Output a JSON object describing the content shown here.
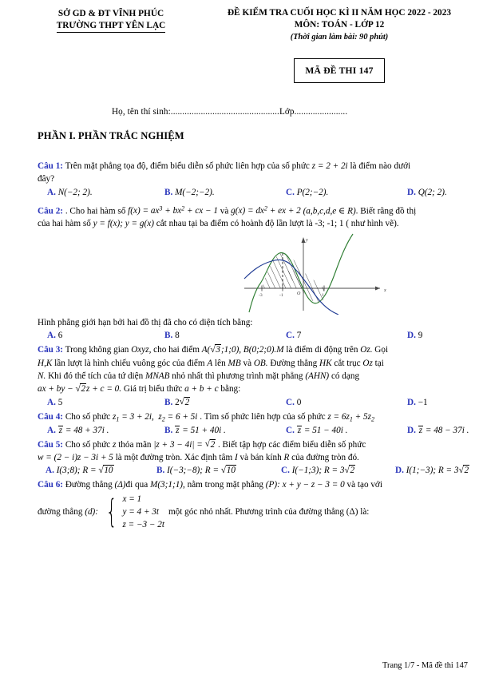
{
  "header": {
    "left_line1": "SỞ GD & ĐT VĨNH PHÚC",
    "left_line2": "TRƯỜNG THPT YÊN LẠC",
    "right_line1": "ĐỀ KIỂM TRA CUỐI HỌC KÌ II NĂM HỌC 2022 - 2023",
    "right_line2": "MÔN: TOÁN - LỚP 12",
    "right_line3": "(Thời gian làm bài: 90 phút)",
    "exam_code": "MÃ ĐỀ THI 147"
  },
  "student_line": "Họ, tên thí sinh:...............................................Lớp.......................",
  "section_title": "PHẦN I. PHẦN TRẮC NGHIỆM",
  "questions": [
    {
      "label": "Câu 1:",
      "text_line1": "Trên mặt phẳng tọa độ, điểm biểu diễn số phức liên hợp của số phức",
      "math1": "z = 2 + 2i",
      "text_line1b": "là điểm nào dưới",
      "text_line2": "đây?",
      "options": [
        {
          "letter": "A.",
          "value": "N(−2; 2)."
        },
        {
          "letter": "B.",
          "value": "M(−2;−2)."
        },
        {
          "letter": "C.",
          "value": "P(2;−2)."
        },
        {
          "letter": "D.",
          "value": "Q(2; 2)."
        }
      ]
    },
    {
      "label": "Câu 2:",
      "text_a": ". Cho hai hàm số",
      "math_f": "f(x) = ax³ + bx² + cx − 1",
      "text_b": "và",
      "math_g": "g(x) = dx² + ex + 2",
      "math_cond": "(a,b,c,d,e ∈ R)",
      "text_c": ". Biết rằng đồ thị",
      "text_line2a": "của hai hàm số",
      "math_yy": "y = f(x); y = g(x)",
      "text_line2b": "cắt nhau tại ba điểm có hoành độ lần lượt là -3; -1; 1 ( như hình vẽ).",
      "after_figure": "Hình phẳng giới hạn bởi hai đồ thị đã cho có diện tích bằng:",
      "options": [
        {
          "letter": "A.",
          "value": "6"
        },
        {
          "letter": "B.",
          "value": "8"
        },
        {
          "letter": "C.",
          "value": "7"
        },
        {
          "letter": "D.",
          "value": "9"
        }
      ]
    },
    {
      "label": "Câu 3:",
      "text_1a": "Trong không gian",
      "math_oxyz": "Oxyz,",
      "text_1b": "cho hai điểm",
      "math_A": "A(√3;1;0), B(0;2;0).",
      "math_M": "M",
      "text_1c": "là điểm di động trên",
      "math_Oz": "Oz.",
      "text_1d": "Gọi",
      "text_2": "H, K lần lượt là hình chiếu vuông góc của điểm A lên MB và OB. Đường thẳng HK cắt trục Oz tại",
      "text_3": "N. Khi đó thể tích của tứ diện MNAB nhỏ nhất thì phương trình mặt phẳng (AHN) có dạng",
      "text_4": "ax + by − √2z + c = 0. Giá trị biểu thức a + b + c bằng:",
      "options": [
        {
          "letter": "A.",
          "value": "5"
        },
        {
          "letter": "B.",
          "value": "2√2"
        },
        {
          "letter": "C.",
          "value": "0"
        },
        {
          "letter": "D.",
          "value": "−1"
        }
      ]
    },
    {
      "label": "Câu 4:",
      "text": "Cho số phức z₁ = 3 + 2i, z₂ = 6 + 5i . Tìm số phức liên hợp của số phức z = 6z₁ + 5z₂",
      "options": [
        {
          "letter": "A.",
          "value": "z̄ = 48 + 37i ."
        },
        {
          "letter": "B.",
          "value": "z̄ = 51 + 40i ."
        },
        {
          "letter": "C.",
          "value": "z̄ = 51 − 40i ."
        },
        {
          "letter": "D.",
          "value": "z̄ = 48 − 37i ."
        }
      ]
    },
    {
      "label": "Câu 5:",
      "text_line1": "Cho số phức z thỏa mãn |z + 3 − 4i| = √2 . Biết tập hợp các điểm biểu diễn số phức",
      "text_line2": "w = (2 − i)z − 3i + 5 là một đường tròn. Xác định tâm I và bán kính R của đường tròn đó.",
      "options": [
        {
          "letter": "A.",
          "value": "I(3;8); R = √10"
        },
        {
          "letter": "B.",
          "value": "I(−3;−8); R = √10"
        },
        {
          "letter": "C.",
          "value": "I(−1;3); R = 3√2"
        },
        {
          "letter": "D.",
          "value": "I(1;−3); R = 3√2"
        }
      ]
    },
    {
      "label": "Câu 6:",
      "text_line1": "Đường thẳng (Δ) đi qua M(3;1;1), nằm trong mặt phẳng (P): x + y − z − 3 = 0 và tạo với",
      "text_prefix": "đường thẳng (d):",
      "system": [
        "x = 1",
        "y = 4 + 3t",
        "z = −3 − 2t"
      ],
      "text_suffix": "một góc nhỏ nhất. Phương trình của đường thẳng (Δ) là:"
    }
  ],
  "figure": {
    "type": "function-graph",
    "axis_labels": {
      "x": "x",
      "y": "y",
      "origin": "O"
    },
    "x_ticks": [
      "-3",
      "-1",
      "1"
    ],
    "curves": [
      {
        "name": "cubic-green",
        "color": "#2e7d32",
        "expr": "f(x) = ax³ + bx² + cx − 1"
      },
      {
        "name": "parabola-blue",
        "color": "#1f3a93",
        "expr": "g(x) = dx² + ex + 2"
      }
    ],
    "shaded_regions": [
      "-3 to -1",
      "-1 to 1"
    ]
  },
  "footer": "Trang 1/7 - Mã đề thi 147",
  "colors": {
    "label_blue": "#2b36bb",
    "curve_green": "#2e7d32",
    "curve_blue": "#1f3a93",
    "text_black": "#000000"
  }
}
